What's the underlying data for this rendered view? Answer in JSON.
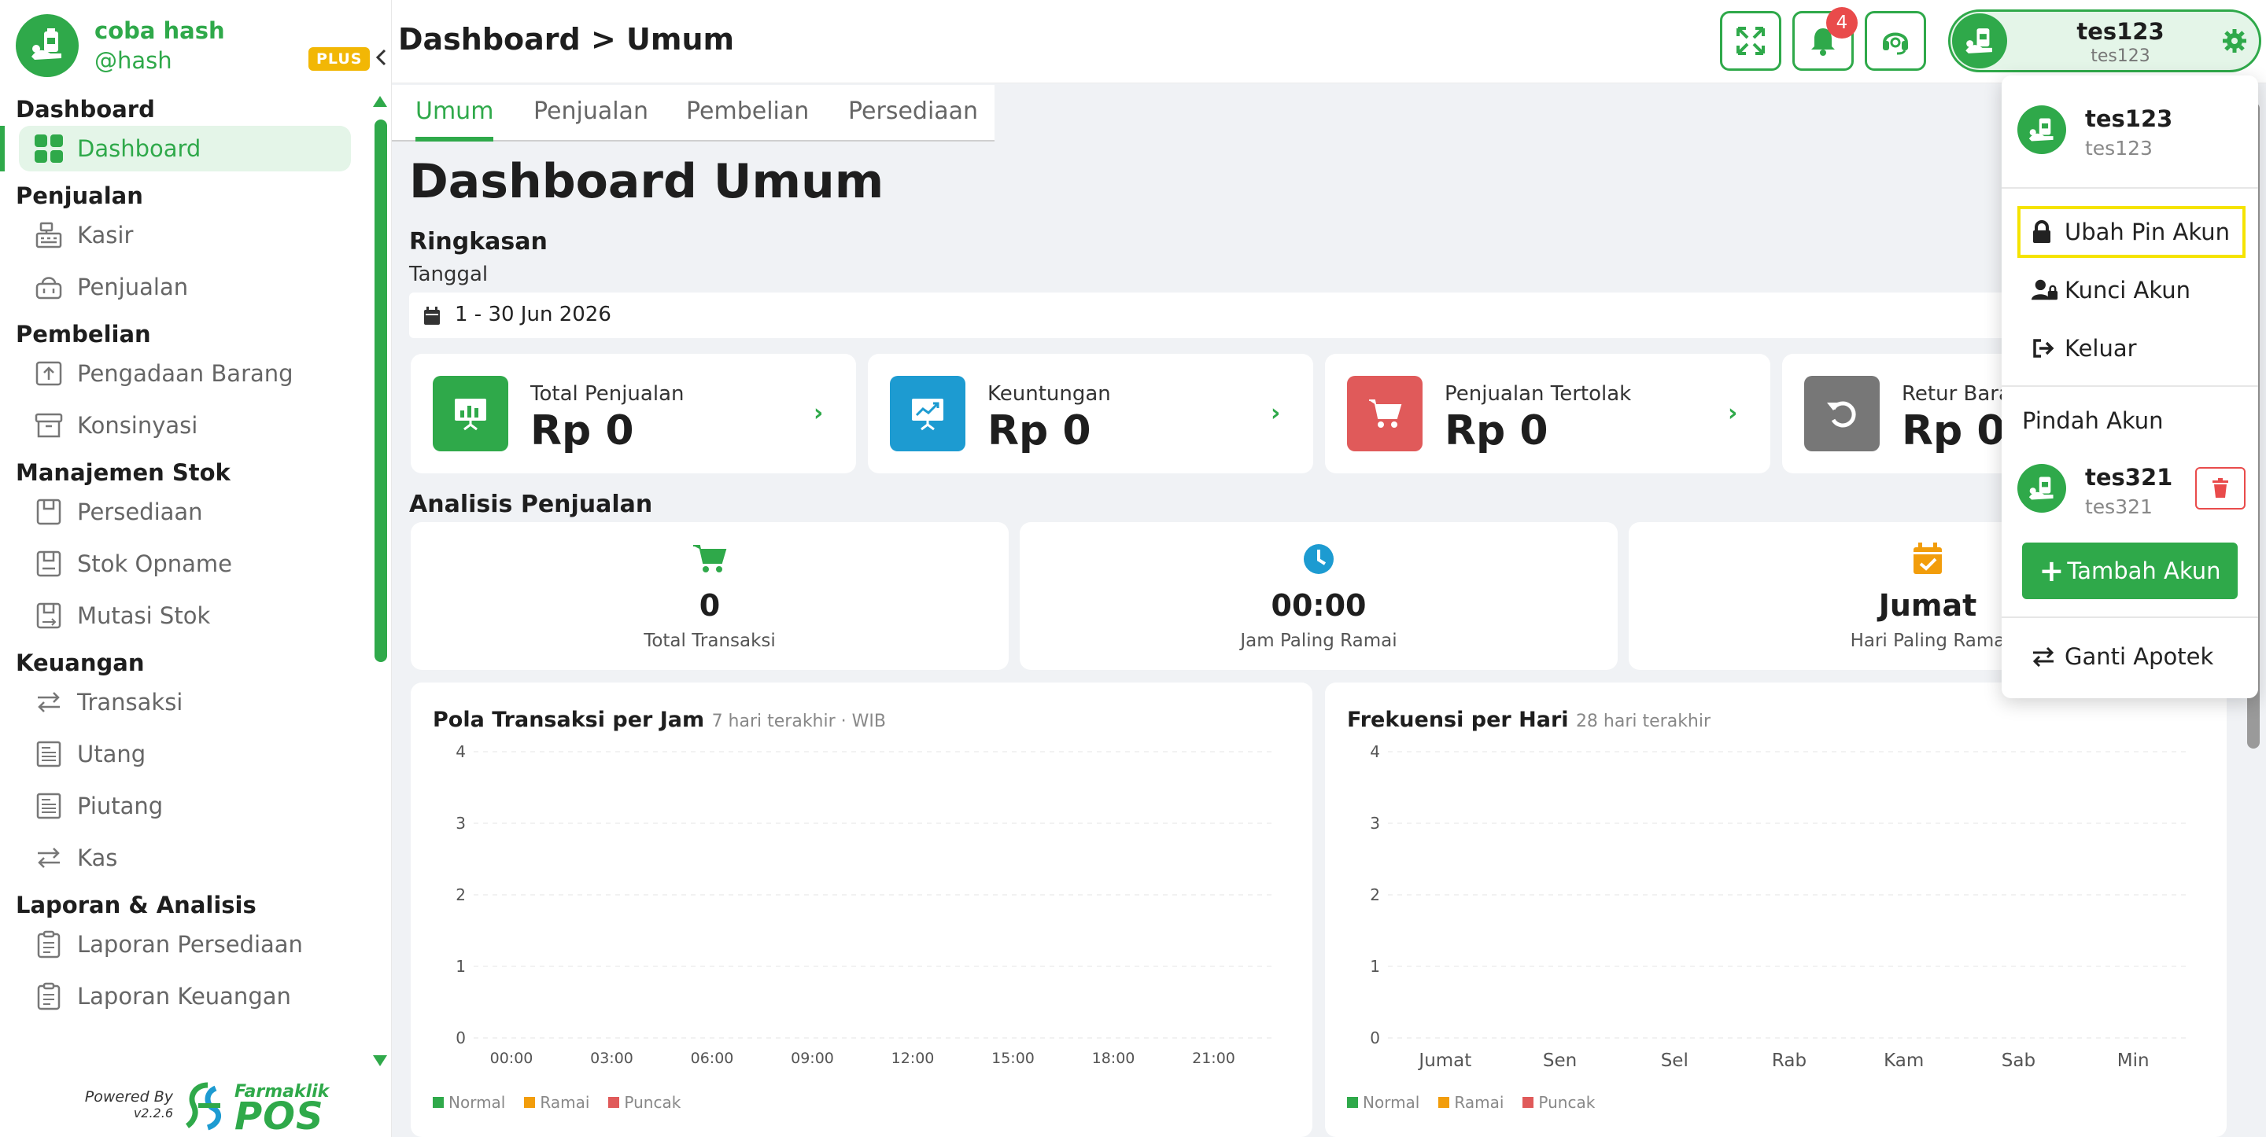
{
  "brand": {
    "name": "coba hash",
    "handle": "@hash",
    "plan_badge": "PLUS",
    "logo_icon": "pharmacy-logo-icon"
  },
  "sidebar": {
    "sections": [
      {
        "title": "Dashboard",
        "items": [
          {
            "label": "Dashboard",
            "icon": "dashboard-grid-icon",
            "active": true
          }
        ]
      },
      {
        "title": "Penjualan",
        "items": [
          {
            "label": "Kasir",
            "icon": "cash-register-icon"
          },
          {
            "label": "Penjualan",
            "icon": "shopping-basket-icon"
          }
        ]
      },
      {
        "title": "Pembelian",
        "items": [
          {
            "label": "Pengadaan Barang",
            "icon": "procurement-icon"
          },
          {
            "label": "Konsinyasi",
            "icon": "archive-box-icon"
          }
        ]
      },
      {
        "title": "Manajemen Stok",
        "items": [
          {
            "label": "Persediaan",
            "icon": "stock-icon"
          },
          {
            "label": "Stok Opname",
            "icon": "stock-opname-icon"
          },
          {
            "label": "Mutasi Stok",
            "icon": "stock-mutation-icon"
          }
        ]
      },
      {
        "title": "Keuangan",
        "items": [
          {
            "label": "Transaksi",
            "icon": "transfer-arrows-icon"
          },
          {
            "label": "Utang",
            "icon": "receipt-icon"
          },
          {
            "label": "Piutang",
            "icon": "receipt-icon"
          },
          {
            "label": "Kas",
            "icon": "transfer-arrows-icon"
          }
        ]
      },
      {
        "title": "Laporan & Analisis",
        "items": [
          {
            "label": "Laporan Persediaan",
            "icon": "clipboard-icon"
          },
          {
            "label": "Laporan Keuangan",
            "icon": "clipboard-icon"
          }
        ]
      }
    ],
    "powered_by": "Powered By",
    "version": "v2.2.6",
    "vendor_small": "Farmaklik",
    "vendor_big": "POS"
  },
  "header": {
    "title": "Dashboard > Umum",
    "notification_count": "4",
    "user": {
      "name": "tes123",
      "sub": "tes123"
    }
  },
  "tabs": [
    "Umum",
    "Penjualan",
    "Pembelian",
    "Persediaan"
  ],
  "main": {
    "title": "Dashboard Umum",
    "summary_title": "Ringkasan",
    "date_label": "Tanggal",
    "date_value": "1 - 30 Jun 2026",
    "stats": [
      {
        "label": "Total Penjualan",
        "value": "Rp 0",
        "color": "#2fa94a",
        "icon": "presentation-chart-icon"
      },
      {
        "label": "Keuntungan",
        "value": "Rp 0",
        "color": "#1d9bd1",
        "icon": "growth-chart-icon"
      },
      {
        "label": "Penjualan Tertolak",
        "value": "Rp 0",
        "color": "#e05a5a",
        "icon": "cart-icon"
      },
      {
        "label": "Retur Bara",
        "value": "Rp 0",
        "color": "#777777",
        "icon": "undo-icon"
      }
    ],
    "analysis_title": "Analisis Penjualan",
    "analysis": [
      {
        "value": "0",
        "label": "Total Transaksi",
        "icon": "cart-icon",
        "color": "#2fa94a"
      },
      {
        "value": "00:00",
        "label": "Jam Paling Ramai",
        "icon": "clock-icon",
        "color": "#1d9bd1"
      },
      {
        "value": "Jumat",
        "label": "Hari Paling Rama",
        "icon": "calendar-check-icon",
        "color": "#f29d0b"
      }
    ]
  },
  "chart_data": [
    {
      "type": "bar",
      "title": "Pola Transaksi per Jam",
      "subtitle": "7 hari terakhir · WIB",
      "categories": [
        "00:00",
        "03:00",
        "06:00",
        "09:00",
        "12:00",
        "15:00",
        "18:00",
        "21:00"
      ],
      "yticks": [
        "0",
        "1",
        "2",
        "3",
        "4"
      ],
      "ylim": [
        0,
        4
      ],
      "series": [
        {
          "name": "Normal",
          "color": "#2fa94a",
          "values": [
            0,
            0,
            0,
            0,
            0,
            0,
            0,
            0
          ]
        },
        {
          "name": "Ramai",
          "color": "#f29d0b",
          "values": [
            0,
            0,
            0,
            0,
            0,
            0,
            0,
            0
          ]
        },
        {
          "name": "Puncak",
          "color": "#e05a5a",
          "values": [
            0,
            0,
            0,
            0,
            0,
            0,
            0,
            0
          ]
        }
      ],
      "legend": "bottom-left",
      "grid": true
    },
    {
      "type": "bar",
      "title": "Frekuensi per Hari",
      "subtitle": "28 hari terakhir",
      "categories": [
        "Jumat",
        "Sen",
        "Sel",
        "Rab",
        "Kam",
        "Sab",
        "Min"
      ],
      "yticks": [
        "0",
        "1",
        "2",
        "3",
        "4"
      ],
      "ylim": [
        0,
        4
      ],
      "series": [
        {
          "name": "Normal",
          "color": "#2fa94a",
          "values": [
            0,
            0,
            0,
            0,
            0,
            0,
            0
          ]
        },
        {
          "name": "Ramai",
          "color": "#f29d0b",
          "values": [
            0,
            0,
            0,
            0,
            0,
            0,
            0
          ]
        },
        {
          "name": "Puncak",
          "color": "#e05a5a",
          "values": [
            0,
            0,
            0,
            0,
            0,
            0,
            0
          ]
        }
      ],
      "legend": "bottom-left",
      "grid": true
    }
  ],
  "dropdown": {
    "user": {
      "name": "tes123",
      "sub": "tes123"
    },
    "items": [
      {
        "label": "Ubah Pin Akun",
        "icon": "lock-icon"
      },
      {
        "label": "Kunci Akun",
        "icon": "user-lock-icon"
      },
      {
        "label": "Keluar",
        "icon": "sign-out-icon"
      }
    ],
    "switch_title": "Pindah Akun",
    "other_account": {
      "name": "tes321",
      "sub": "tes321"
    },
    "add_account": "Tambah Akun",
    "change_pharmacy": "Ganti Apotek"
  },
  "colors": {
    "accent": "#2fa94a",
    "badge": "#e94b4b",
    "focus_outline": "#f5e300"
  }
}
